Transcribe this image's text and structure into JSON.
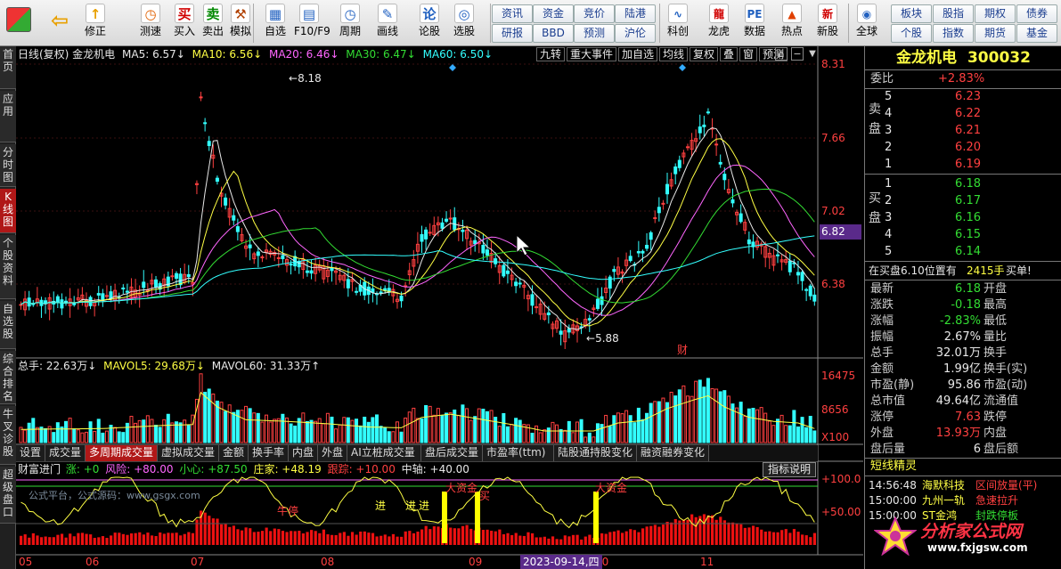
{
  "toolbar": {
    "buttons": [
      {
        "label": "修正",
        "icon": "↑",
        "color": "#e8a000"
      },
      {
        "label": "测速",
        "icon": "◷",
        "color": "#e06000"
      },
      {
        "label": "买入",
        "icon": "买",
        "color": "#d00000"
      },
      {
        "label": "卖出",
        "icon": "卖",
        "color": "#008800"
      },
      {
        "label": "模拟",
        "icon": "⚒",
        "color": "#b04000"
      },
      {
        "label": "自选",
        "icon": "▦",
        "color": "#2060c0"
      },
      {
        "label": "F10/F9",
        "icon": "▤",
        "color": "#2060c0"
      },
      {
        "label": "周期",
        "icon": "◷",
        "color": "#2060c0"
      },
      {
        "label": "画线",
        "icon": "✎",
        "color": "#2060c0"
      },
      {
        "label": "论股",
        "icon": "论",
        "color": "#2060c0"
      },
      {
        "label": "选股",
        "icon": "◎",
        "color": "#2060c0"
      }
    ],
    "links_row1": [
      "资讯",
      "资金",
      "竞价",
      "陆港"
    ],
    "links_row2": [
      "研报",
      "BBD",
      "预测",
      "沪伦"
    ],
    "buttons2": [
      {
        "label": "科创",
        "icon": "∿",
        "color": "#2060c0"
      },
      {
        "label": "龙虎",
        "icon": "龍",
        "color": "#d00000"
      },
      {
        "label": "数据",
        "icon": "PE",
        "color": "#2060c0"
      },
      {
        "label": "热点",
        "icon": "▲",
        "color": "#e04000"
      },
      {
        "label": "新股",
        "icon": "新",
        "color": "#d00000"
      },
      {
        "label": "全球",
        "icon": "◉",
        "color": "#2060c0"
      }
    ],
    "links_row3": [
      "板块",
      "股指",
      "期权",
      "债券"
    ],
    "links_row4": [
      "个股",
      "指数",
      "期货",
      "基金"
    ]
  },
  "leftnav": [
    "首页",
    "应用",
    "分时图",
    "K线图",
    "个股资料",
    "自选股",
    "综合排名",
    "牛叉诊股",
    "超级盘口"
  ],
  "chart": {
    "header": "日线(复权) 金龙机电",
    "ma5": "MA5: 6.57↓",
    "ma10": "MA10: 6.56↓",
    "ma20": "MA20: 6.46↓",
    "ma30": "MA30: 6.47↓",
    "ma60": "MA60: 6.50↓",
    "top_buttons": [
      "九转",
      "重大事件",
      "加自选",
      "均线",
      "复权",
      "叠",
      "窗",
      "预测"
    ],
    "price_ticks": [
      "8.31",
      "7.66",
      "7.02",
      "6.38"
    ],
    "current_price_tag": "6.82",
    "high_label": "8.18",
    "low_label": "5.88",
    "event_marker": "财",
    "vol_header_total": "总手: 22.63万↓",
    "vol_header_mavol5": "MAVOL5: 29.68万↓",
    "vol_header_mavol60": "MAVOL60: 31.33万↑",
    "vol_ticks": [
      "16475",
      "8656",
      "X100"
    ],
    "tabs": [
      "设置",
      "成交量",
      "多周期成交量",
      "虚拟成交量",
      "金额",
      "换手率",
      "内盘",
      "外盘",
      "AI立桩成交量",
      "盘后成交量",
      "市盈率(ttm)",
      "陆股通持股变化",
      "融资融券变化"
    ],
    "ind_header_label": "财富进门",
    "ind_rise": "涨: +0",
    "ind_risk": "风险: +80.00",
    "ind_careful": "小心: +87.50",
    "ind_dealer": "庄家: +48.19",
    "ind_follow": "跟踪: +10.00",
    "ind_axis": "中轴: +40.00",
    "ind_explain_button": "指标说明",
    "ind_ticks": [
      "+100.0",
      "+50.00"
    ],
    "watermark_text": "公式平台，公式源码：www.gsgx.com",
    "overlay_texts": [
      "大资金",
      "大资金",
      "买",
      "进",
      "进",
      "进",
      "牛停"
    ],
    "x_ticks": [
      "05",
      "06",
      "07",
      "08",
      "09",
      "10",
      "11"
    ],
    "date_tag": "2023-09-14,四"
  },
  "stock": {
    "name": "金龙机电",
    "code": "300032",
    "weibi_label": "委比",
    "weibi": "+2.83%",
    "sell_label": "卖盘",
    "buy_label": "买盘",
    "sells": [
      {
        "lvl": "5",
        "price": "6.23"
      },
      {
        "lvl": "4",
        "price": "6.22"
      },
      {
        "lvl": "3",
        "price": "6.21"
      },
      {
        "lvl": "2",
        "price": "6.20"
      },
      {
        "lvl": "1",
        "price": "6.19"
      }
    ],
    "buys": [
      {
        "lvl": "1",
        "price": "6.18"
      },
      {
        "lvl": "2",
        "price": "6.17"
      },
      {
        "lvl": "3",
        "price": "6.16"
      },
      {
        "lvl": "4",
        "price": "6.15"
      },
      {
        "lvl": "5",
        "price": "6.14"
      }
    ],
    "notice_text": "在买盘6.10位置有",
    "notice_qty": "2415手",
    "notice_tail": "买单!",
    "quotes": [
      {
        "l": "最新",
        "v": "6.18",
        "c": "dn",
        "l2": "开盘"
      },
      {
        "l": "涨跌",
        "v": "-0.18",
        "c": "dn",
        "l2": "最高"
      },
      {
        "l": "涨幅",
        "v": "-2.83%",
        "c": "dn",
        "l2": "最低"
      },
      {
        "l": "振幅",
        "v": "2.67%",
        "c": "wh",
        "l2": "量比"
      },
      {
        "l": "总手",
        "v": "32.01万",
        "c": "wh",
        "l2": "换手"
      },
      {
        "l": "金额",
        "v": "1.99亿",
        "c": "wh",
        "l2": "换手(实)"
      },
      {
        "l": "市盈(静)",
        "v": "95.86",
        "c": "wh",
        "l2": "市盈(动)"
      },
      {
        "l": "总市值",
        "v": "49.64亿",
        "c": "wh",
        "l2": "流通值"
      },
      {
        "l": "涨停",
        "v": "7.63",
        "c": "up",
        "l2": "跌停"
      },
      {
        "l": "外盘",
        "v": "13.93万",
        "c": "up",
        "l2": "内盘"
      },
      {
        "l": "盘后量",
        "v": "6",
        "c": "wh",
        "l2": "盘后额"
      }
    ],
    "news_title": "短线精灵",
    "news": [
      {
        "time": "14:56:48",
        "name": "海默科技",
        "event": "区间放量(平)",
        "c": "up"
      },
      {
        "time": "15:00:00",
        "name": "九州一轨",
        "event": "急速拉升",
        "c": "up"
      },
      {
        "time": "15:00:00",
        "name": "ST金鸿",
        "event": "封跌停板",
        "c": "dn"
      }
    ],
    "logo_text": "分析家公式网",
    "logo_url": "www.fxjgsw.com",
    "colors": {
      "up": "#ff4040",
      "down": "#33ffff",
      "title": "#ffff44"
    }
  }
}
